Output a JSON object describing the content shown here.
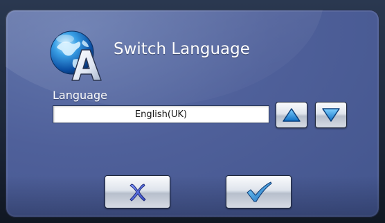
{
  "dialog": {
    "title": "Switch Language",
    "icon": "globe-language-icon"
  },
  "language": {
    "label": "Language",
    "value": "English(UK)"
  },
  "controls": {
    "up_icon": "triangle-up-icon",
    "down_icon": "triangle-down-icon",
    "cancel_icon": "x-icon",
    "ok_icon": "checkmark-icon"
  },
  "colors": {
    "panel": "#4f609a",
    "arrow_fill": "#1a8fe0",
    "cancel_x": "#4a62d6",
    "ok_check": "#2d7fc8"
  }
}
